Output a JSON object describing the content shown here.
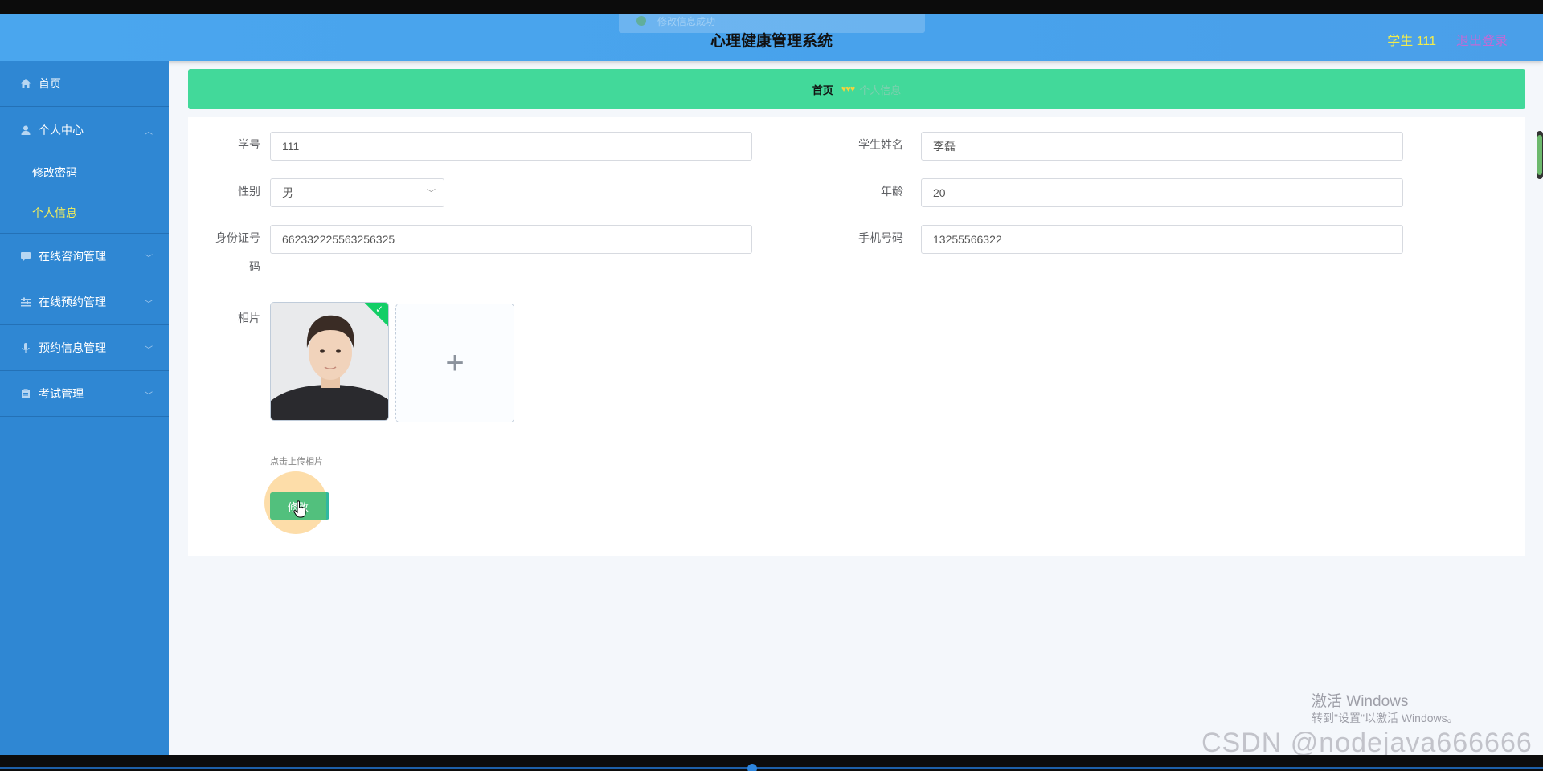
{
  "header": {
    "title": "心理健康管理系统",
    "user_label": "学生 111",
    "logout_label": "退出登录",
    "toast_text": "修改信息成功"
  },
  "sidebar": {
    "items": [
      {
        "label": "首页",
        "icon": "home-icon"
      },
      {
        "label": "个人中心",
        "icon": "user-icon",
        "expanded": true,
        "children": [
          {
            "label": "修改密码",
            "active": false
          },
          {
            "label": "个人信息",
            "active": true
          }
        ]
      },
      {
        "label": "在线咨询管理",
        "icon": "chat-icon"
      },
      {
        "label": "在线预约管理",
        "icon": "sliders-icon"
      },
      {
        "label": "预约信息管理",
        "icon": "mic-icon"
      },
      {
        "label": "考试管理",
        "icon": "clipboard-icon"
      }
    ],
    "colors": {
      "background": "#2f87d3",
      "active_text": "#f3ee5a"
    }
  },
  "breadcrumb": {
    "home": "首页",
    "separator": "♥♥♥",
    "current": "个人信息"
  },
  "form": {
    "student_id": {
      "label": "学号",
      "value": "111"
    },
    "student_name": {
      "label": "学生姓名",
      "value": "李磊"
    },
    "gender": {
      "label": "性别",
      "value": "男"
    },
    "age": {
      "label": "年龄",
      "value": "20"
    },
    "id_card": {
      "label_line1": "身份证号",
      "label_line2": "码",
      "value": "662332225563256325"
    },
    "phone": {
      "label": "手机号码",
      "value": "13255566322"
    },
    "photo": {
      "label": "相片",
      "hint": "点击上传相片"
    },
    "submit_label": "修改"
  },
  "watermark": {
    "line1": "激活 Windows",
    "line2": "转到\"设置\"以激活 Windows。",
    "csdn": "CSDN @nodejava666666"
  },
  "colors": {
    "header_gradient": "#4aa6ee",
    "breadcrumb_bg": "#42d99a",
    "save_button": "#52c07d"
  }
}
